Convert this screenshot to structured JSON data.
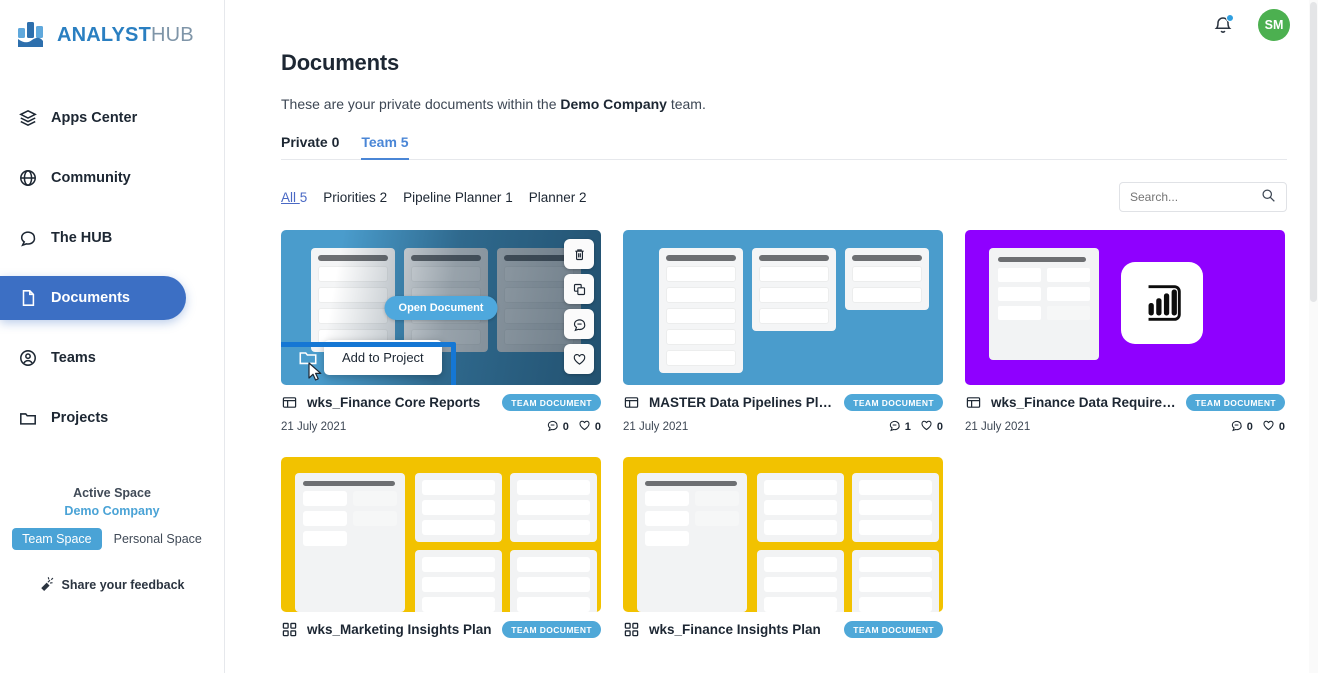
{
  "brand": {
    "part1": "ANALYST",
    "part2": "HUB",
    "logo_icon": "analysthub-logo-icon"
  },
  "sidebar": {
    "items": [
      {
        "label": "Apps Center",
        "icon": "layers-icon",
        "active": false
      },
      {
        "label": "Community",
        "icon": "globe-icon",
        "active": false
      },
      {
        "label": "The HUB",
        "icon": "chat-bubble-icon",
        "active": false
      },
      {
        "label": "Documents",
        "icon": "document-icon",
        "active": true
      },
      {
        "label": "Teams",
        "icon": "teams-icon",
        "active": false
      },
      {
        "label": "Projects",
        "icon": "folder-icon",
        "active": false
      }
    ],
    "space": {
      "title": "Active Space",
      "name": "Demo Company",
      "team_space": "Team Space",
      "personal_space": "Personal Space",
      "feedback": "Share your feedback",
      "feedback_icon": "megaphone-icon"
    }
  },
  "topbar": {
    "bell_icon": "notification-bell-icon",
    "avatar_initials": "SM"
  },
  "main": {
    "title": "Documents",
    "subtitle_before": "These are your private documents within the ",
    "subtitle_bold": "Demo Company",
    "subtitle_after": " team.",
    "tabs": [
      {
        "label": "Private 0",
        "active": false
      },
      {
        "label": "Team 5",
        "active": true
      }
    ],
    "filters": [
      {
        "label": "All",
        "count": "5",
        "active": true
      },
      {
        "label": "Priorities",
        "count": "2",
        "active": false
      },
      {
        "label": "Pipeline Planner",
        "count": "1",
        "active": false
      },
      {
        "label": "Planner",
        "count": "2",
        "active": false
      }
    ],
    "search": {
      "placeholder": "Search...",
      "value": "",
      "icon": "search-icon"
    }
  },
  "hover_card": {
    "open_button": "Open Document",
    "tooltip": "Add to Project",
    "folder_icon": "add-to-project-folder-icon",
    "actions": [
      {
        "name": "delete-icon",
        "title": "Delete"
      },
      {
        "name": "duplicate-icon",
        "title": "Duplicate"
      },
      {
        "name": "comment-icon",
        "title": "Comment"
      },
      {
        "name": "favorite-heart-icon",
        "title": "Favorite"
      }
    ]
  },
  "cards": [
    {
      "title": "wks_Finance Core Reports",
      "badge": "TEAM DOCUMENT",
      "date": "21 July 2021",
      "comments": "0",
      "likes": "0",
      "color": "#4a9ccc",
      "type": "kanban",
      "icon": "document-card-icon",
      "hovered": true,
      "columns": [
        4,
        4,
        4
      ]
    },
    {
      "title": "MASTER Data Pipelines Planning",
      "badge": "TEAM DOCUMENT",
      "date": "21 July 2021",
      "comments": "1",
      "likes": "0",
      "color": "#4a9ccc",
      "type": "kanban",
      "icon": "document-card-icon",
      "hovered": false,
      "columns": [
        5,
        3,
        2
      ]
    },
    {
      "title": "wks_Finance Data Requirements",
      "badge": "TEAM DOCUMENT",
      "date": "21 July 2021",
      "comments": "0",
      "likes": "0",
      "color": "#8f00ff",
      "type": "powerbi",
      "icon": "document-card-icon",
      "hovered": false,
      "powerbi_icon": "power-bi-icon"
    },
    {
      "title": "wks_Marketing Insights Plan",
      "badge": "TEAM DOCUMENT",
      "date": "",
      "comments": "",
      "likes": "",
      "color": "#f2c200",
      "type": "dashboard",
      "icon": "grid-dashboard-icon",
      "hovered": false
    },
    {
      "title": "wks_Finance Insights Plan",
      "badge": "TEAM DOCUMENT",
      "date": "",
      "comments": "",
      "likes": "",
      "color": "#f2c200",
      "type": "dashboard",
      "icon": "grid-dashboard-icon",
      "hovered": false
    }
  ],
  "colors": {
    "accent_blue": "#3c6fc4",
    "card_blue": "#4a9ccc",
    "card_purple": "#8f00ff",
    "card_yellow": "#f2c200",
    "badge_blue": "#4fa8d8",
    "avatar_green": "#4cb050",
    "focus_ring": "#1577d4"
  }
}
